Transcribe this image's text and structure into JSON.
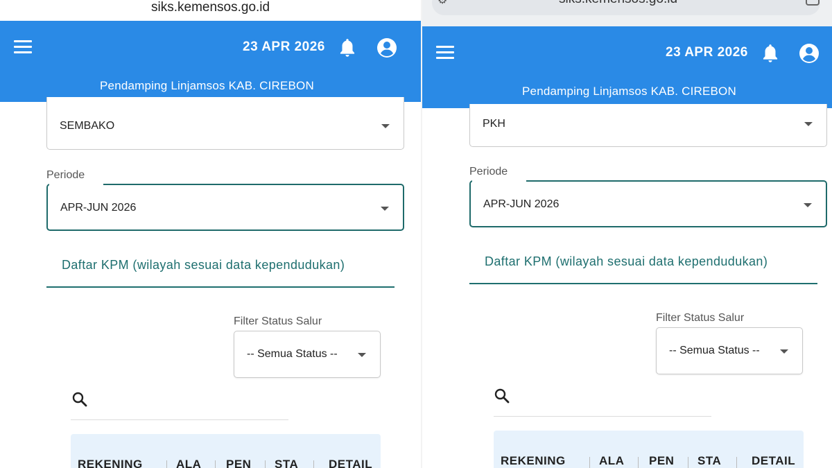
{
  "left": {
    "url": "siks.kemensos.go.id",
    "date": "23 APR 2026",
    "subtitle": "Pendamping Linjamsos KAB. CIREBON",
    "program_value": "SEMBAKO",
    "periode_label": "Periode",
    "periode_value": "APR-JUN 2026",
    "tab_label": "Daftar KPM (wilayah sesuai data kependudukan)",
    "filter_label": "Filter Status Salur",
    "filter_value": "-- Semua Status --",
    "columns": [
      "REKENING",
      "ALA",
      "PEN",
      "STA",
      "DETAIL"
    ]
  },
  "right": {
    "url": "siks.kemensos.go.id",
    "date": "23 APR 2026",
    "subtitle": "Pendamping Linjamsos KAB. CIREBON",
    "program_value": "PKH",
    "periode_label": "Periode",
    "periode_value": "APR-JUN 2026",
    "tab_label": "Daftar KPM (wilayah sesuai data kependudukan)",
    "filter_label": "Filter Status Salur",
    "filter_value": "-- Semua Status --",
    "columns": [
      "REKENING",
      "ALA",
      "PEN",
      "STA",
      "DETAIL"
    ]
  },
  "colors": {
    "appbar": "#2a8ae6",
    "accent": "#1e6f6f",
    "table_header": "#e7f2fc"
  },
  "icons": [
    "menu-icon",
    "bell-icon",
    "account-icon",
    "dropdown-caret-icon",
    "search-icon"
  ]
}
